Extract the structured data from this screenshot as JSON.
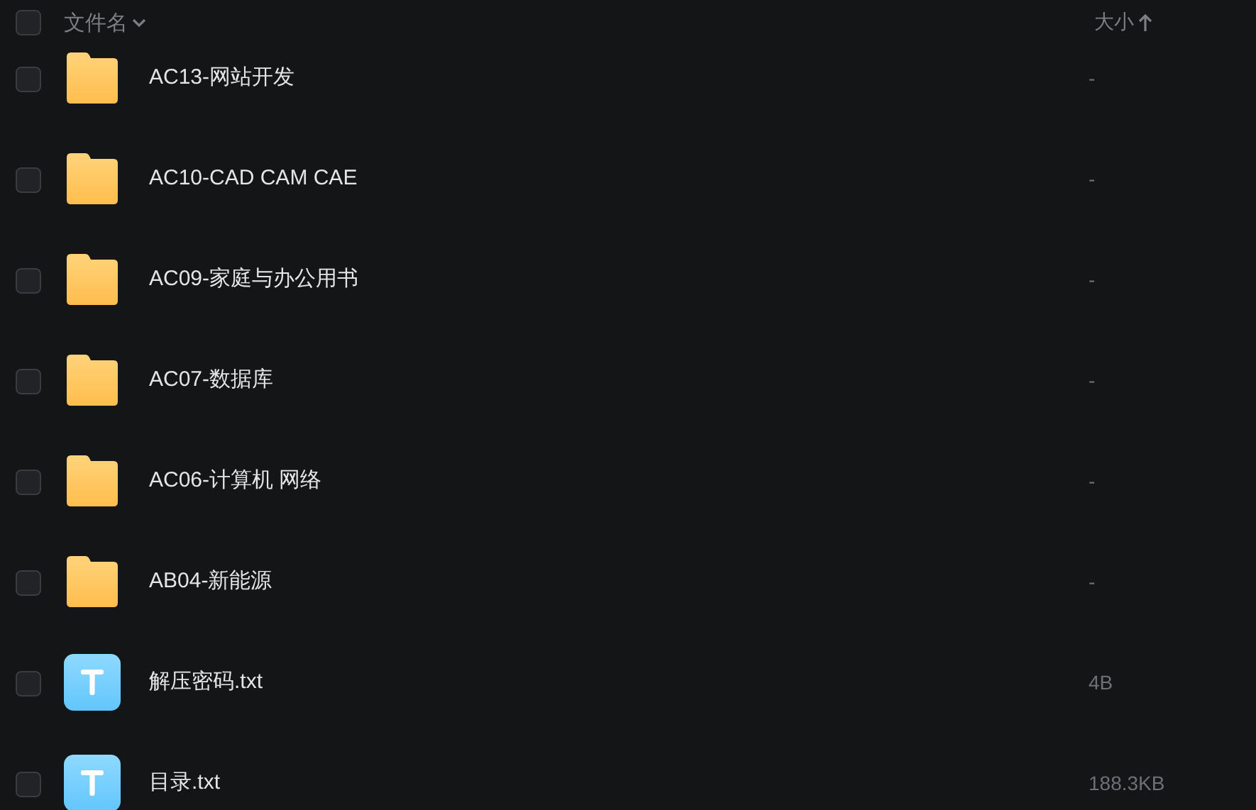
{
  "header": {
    "checked": false,
    "columns": [
      {
        "label": "文件名"
      },
      {
        "label": "大小"
      }
    ]
  },
  "rows": [
    {
      "kind": "folder",
      "name": "AC13-网站开发",
      "size": "-",
      "checked": false
    },
    {
      "kind": "folder",
      "name": "AC10-CAD CAM CAE",
      "size": "-",
      "checked": false
    },
    {
      "kind": "folder",
      "name": "AC09-家庭与办公用书",
      "size": "-",
      "checked": false
    },
    {
      "kind": "folder",
      "name": "AC07-数据库",
      "size": "-",
      "checked": false
    },
    {
      "kind": "folder",
      "name": "AC06-计算机 网络",
      "size": "-",
      "checked": false
    },
    {
      "kind": "folder",
      "name": "AB04-新能源",
      "size": "-",
      "checked": false
    },
    {
      "kind": "text",
      "name": "解压密码.txt",
      "size": "4B",
      "checked": false
    },
    {
      "kind": "text",
      "name": "目录.txt",
      "size": "188.3KB",
      "checked": false
    }
  ]
}
